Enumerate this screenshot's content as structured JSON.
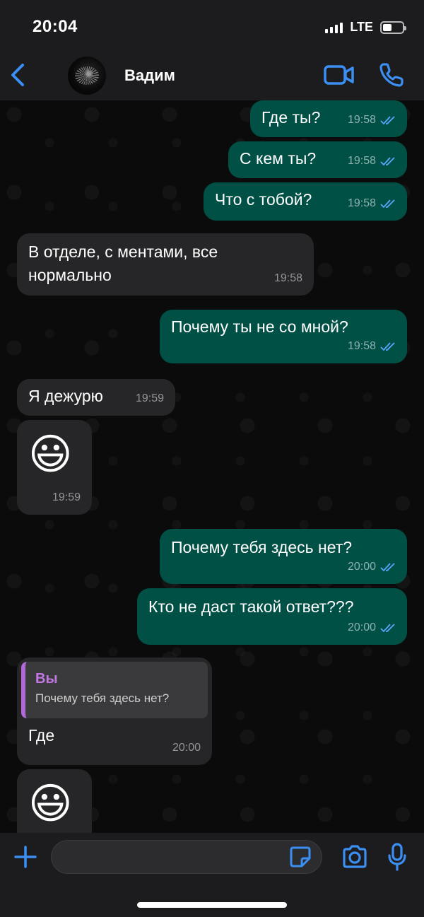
{
  "status_bar": {
    "time": "20:04",
    "network": "LTE"
  },
  "header": {
    "contact_name": "Вадим"
  },
  "messages": [
    {
      "text": "Где ты?",
      "time": "19:58"
    },
    {
      "text": "С кем ты?",
      "time": "19:58"
    },
    {
      "text": "Что с тобой?",
      "time": "19:58"
    },
    {
      "line1": "В отделе, с ментами, все",
      "line2": "нормально",
      "time": "19:58"
    },
    {
      "text": "Почему ты не со мной?",
      "time": "19:58"
    },
    {
      "text": "Я дежурю",
      "time": "19:59"
    },
    {
      "emoji": "😃",
      "time": "19:59"
    },
    {
      "text": "Почему тебя здесь нет?",
      "time": "20:00"
    },
    {
      "text": "Кто не даст такой ответ???",
      "time": "20:00"
    },
    {
      "reply_name": "Вы",
      "reply_text": "Почему тебя здесь нет?",
      "text": "Где",
      "time": "20:00"
    },
    {
      "emoji": "😃"
    }
  ],
  "colors": {
    "outgoing_bubble": "#005046",
    "incoming_bubble": "#262628",
    "accent": "#3c8ff2",
    "reply_accent": "#c277e3",
    "read_ticks": "#5aa7ff"
  },
  "icons": [
    "back-chevron-icon",
    "video-call-icon",
    "phone-icon",
    "plus-icon",
    "sticker-icon",
    "camera-icon",
    "microphone-icon",
    "double-check-icon"
  ]
}
